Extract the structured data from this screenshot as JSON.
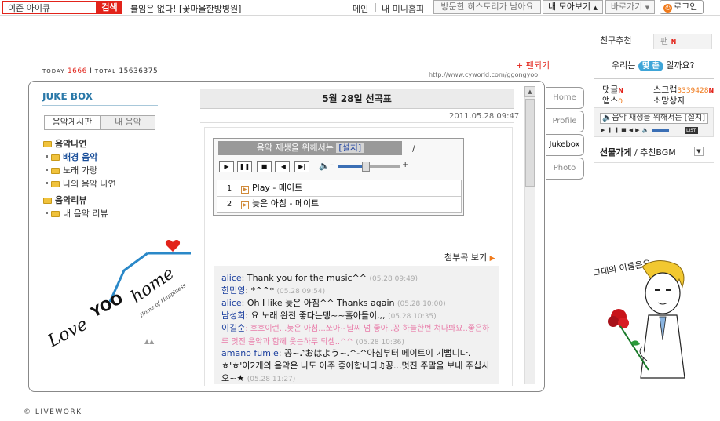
{
  "topbar": {
    "search_value": "이준 아이큐",
    "search_button": "검색",
    "promo": "불임은 없다! [꽃마을한방병원]",
    "nav_main": "메인",
    "nav_minihompy": "내 미니홈피",
    "nav_history": "방문한 히스토리가 남아요",
    "nav_collection": "내 모아보기",
    "nav_shortcut": "바로가기",
    "login": "로그인"
  },
  "counter": {
    "today_label": "TODAY",
    "today": "1666",
    "sep": "I",
    "total_label": "TOTAL",
    "total": "15636375"
  },
  "header": {
    "fan_link": "+ 팬되기",
    "url": "http://www.cyworld.com/ggongyoo"
  },
  "jukebox": {
    "title": "JUKE BOX",
    "tabs": [
      "음악게시판",
      "내 음악"
    ],
    "tree": [
      {
        "label": "음악나연",
        "level": 0
      },
      {
        "label": "배경 음악",
        "level": 1
      },
      {
        "label": "노래 가랑",
        "level": 1
      },
      {
        "label": "나의 음악 나연",
        "level": 1
      },
      {
        "label": "음악리뷰",
        "level": 0
      },
      {
        "label": "내 음악 리뷰",
        "level": 1
      }
    ]
  },
  "post": {
    "title": "5월 28일 선곡표",
    "date": "2011.05.28 09:47",
    "player_text": "음악 재생을 위해서는",
    "player_install": "[설치]",
    "player_slash": "/",
    "volume_level": 0.45,
    "tracks": [
      {
        "num": "1",
        "title": "Play - 메이트"
      },
      {
        "num": "2",
        "title": "늦은 아침 - 메이트"
      }
    ],
    "attach": "첨부곡 보기"
  },
  "comments": [
    {
      "author": "alice",
      "text": ": Thank you for the music^^",
      "time": "(05.28 09:49)"
    },
    {
      "author": "한민영",
      "text": ": *^^*",
      "time": "(05.28 09:54)"
    },
    {
      "author": "alice",
      "text": ": Oh I like 늦은 아침^^ Thanks again",
      "time": "(05.28 10:00)"
    },
    {
      "author": "남성희",
      "text": ": 요 노래 완전 좋다는뎅~~홀아들이,,,",
      "time": "(05.28 10:35)"
    },
    {
      "author": "이길순",
      "text": ": 흐흐이런...늦은 아침...쪼아~날씨 넘 좋아..꽁 하늘한번 쳐다봐요..좋은하루 멋진 음악과 함께 웃는하루 되셈..^^",
      "time": "(05.28 10:36)"
    },
    {
      "author": "amano fumie",
      "text": ": 꽁~♪おはよう~.^-^아침부터 메이트이 기뻡니다. ㅎ'ㅎ'이2개의 음악은 나도 아주 좋아합니다♫꽁...멋진 주말을 보내 주십시오~★",
      "time": "(05.28 11:27)"
    }
  ],
  "side_tabs": [
    "Home",
    "Profile",
    "Jukebox",
    "Photo"
  ],
  "sidebar": {
    "friend_tab": "친구추천",
    "fan_tab": "팬",
    "new_badge": "N",
    "who_prefix": "우리는",
    "who_pill": "몇 촌",
    "who_suffix": "일까요?",
    "stats": [
      {
        "label": "댓글",
        "count": ""
      },
      {
        "label": "스크랩",
        "count": "3339428"
      },
      {
        "label": "앱스",
        "count": "0"
      },
      {
        "label": "소망상자",
        "count": ""
      }
    ],
    "player_text": "음악 재생을 위해서는 [설치]",
    "player_list": "LIST",
    "gift_bold": "선물가게",
    "gift_rest": " / 추천BGM"
  },
  "logo_text": {
    "love": "Love",
    "yoo": "YOO",
    "home": "home",
    "sub": "Home of Happiness"
  },
  "boy_caption": "그대의 이름은요",
  "copyright": "© LIVEWORK",
  "colors": {
    "accent": "#e2231a",
    "blue": "#2a78a8",
    "orange": "#f07a1b"
  }
}
